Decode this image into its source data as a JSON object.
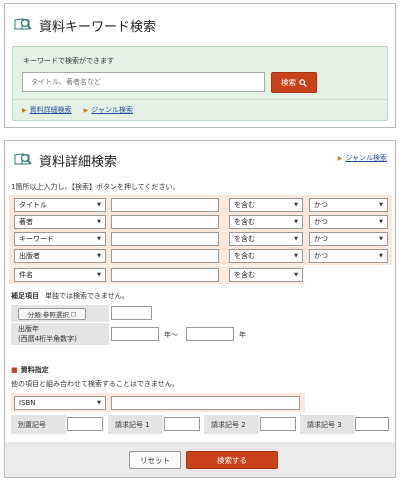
{
  "keyword_panel": {
    "title": "資料キーワード検索",
    "hint": "キーワードで検索ができます",
    "input_placeholder": "タイトル、著者名など",
    "search_label": "検索",
    "links": [
      "資料詳細検索",
      "ジャンル検索"
    ]
  },
  "detail_panel": {
    "title": "資料詳細検索",
    "genre_link": "ジャンル検索",
    "instruction": "1箇所以上入力し、【検索】ボタンを押してください。",
    "field_rows": [
      {
        "field": "タイトル",
        "match": "を含む",
        "logic": "かつ"
      },
      {
        "field": "著者",
        "match": "を含む",
        "logic": "かつ"
      },
      {
        "field": "キーワード",
        "match": "を含む",
        "logic": "かつ"
      },
      {
        "field": "出版者",
        "match": "を含む",
        "logic": "かつ"
      },
      {
        "field": "件名",
        "match": "を含む",
        "logic": ""
      }
    ],
    "supplement": {
      "heading": "補足項目",
      "note": "単独では検索できません。",
      "classification_label": "分類:参照選択",
      "year_label_1": "出版年",
      "year_label_2": "(西暦4桁半角数字)",
      "year_from_suffix": "年〜",
      "year_to_suffix": "年"
    },
    "material": {
      "heading": "資料指定",
      "note": "他の項目と組み合わせて検索することはできません。",
      "id_type": "ISBN",
      "labels": [
        "別置記号",
        "請求記号 1",
        "請求記号 2",
        "請求記号 3"
      ]
    },
    "reset_label": "リセット",
    "submit_label": "検索する"
  },
  "colors": {
    "accent_red": "#c9421c",
    "green_panel": "#e3f1e7",
    "row_highlight": "#fbe8dc",
    "link": "#2b4fa0"
  },
  "icons": [
    "magnifier-book-icon",
    "search-icon",
    "triangle-right-icon",
    "chevron-down-icon"
  ]
}
